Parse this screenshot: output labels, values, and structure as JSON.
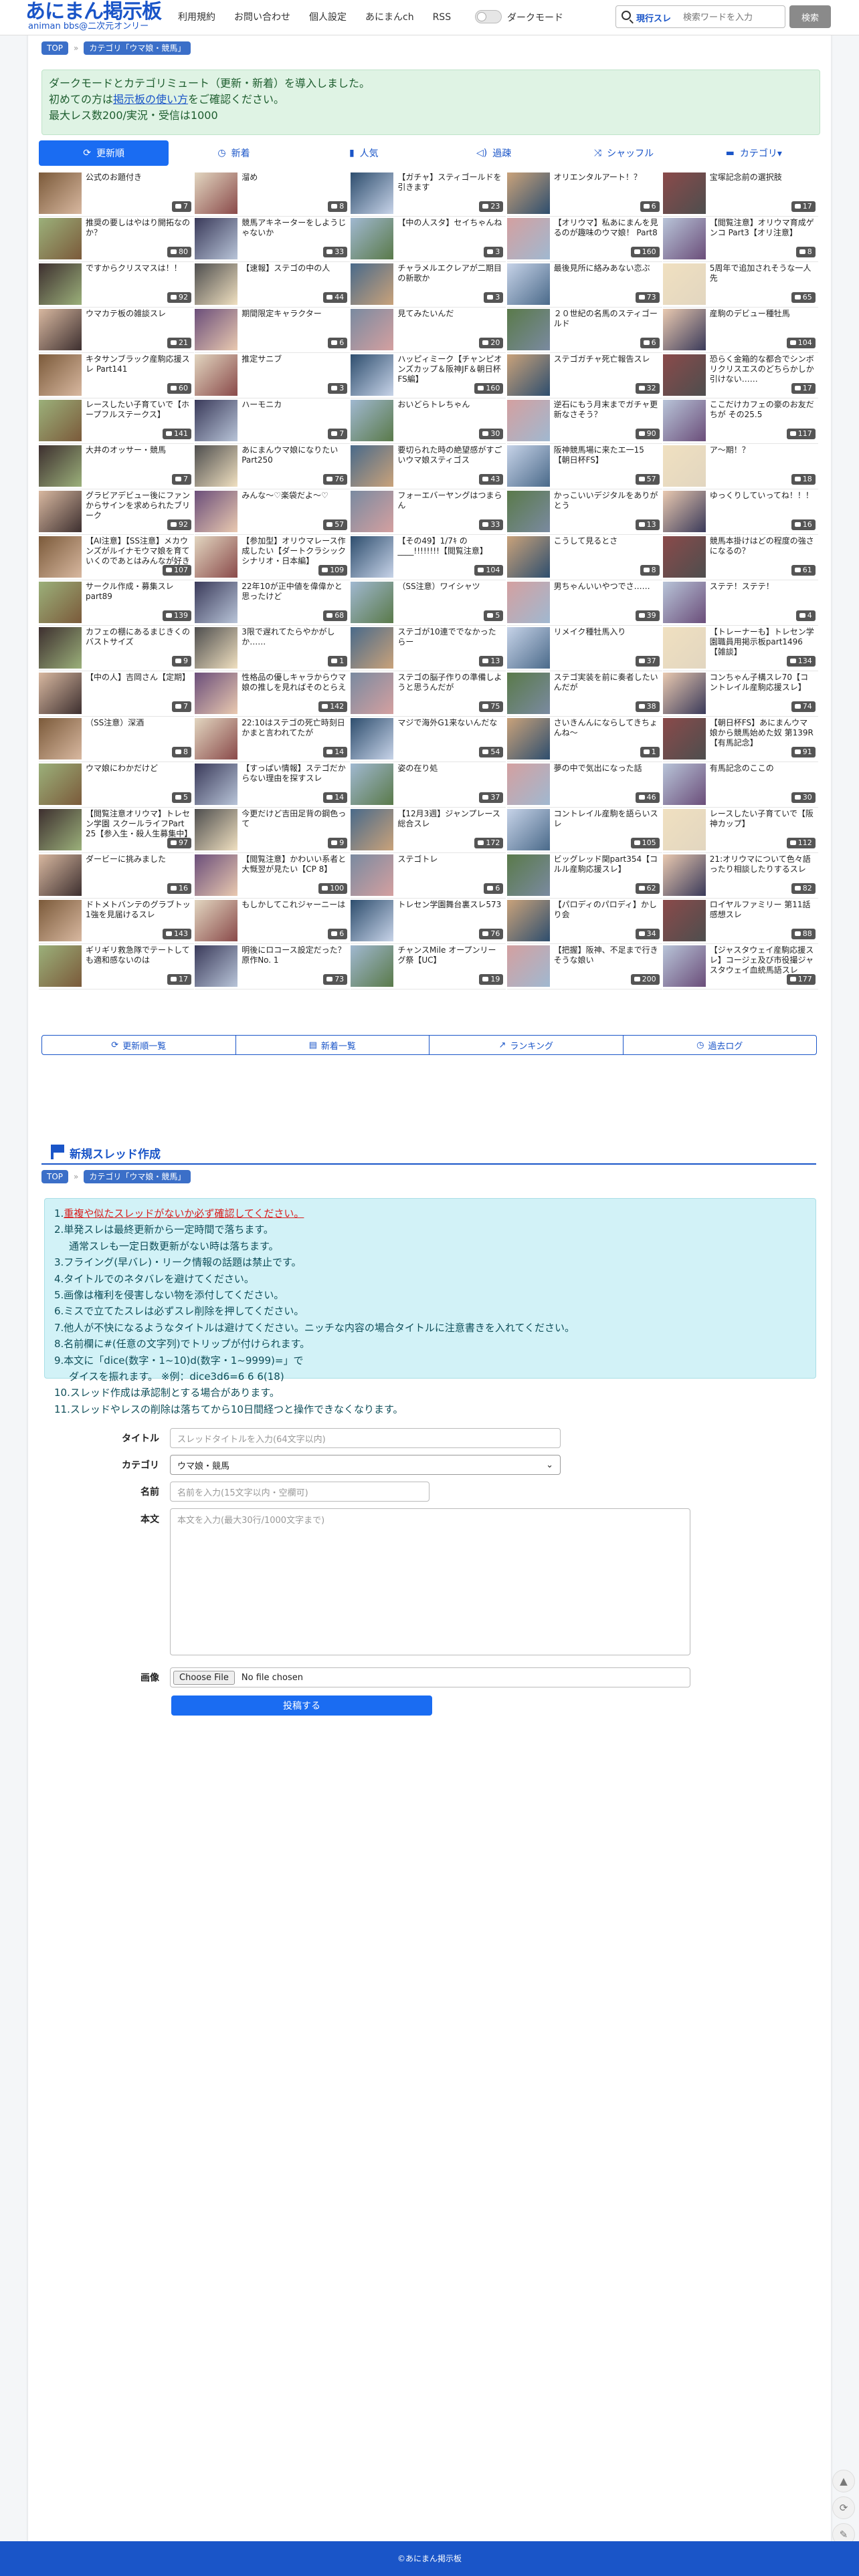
{
  "header": {
    "logo_main": "あにまん掲示板",
    "logo_sub": "animan bbs@二次元オンリー",
    "nav": [
      "利用規約",
      "お問い合わせ",
      "個人設定",
      "あにまんch",
      "RSS"
    ],
    "dark_mode_label": "ダークモード",
    "search_scope": "現行スレ",
    "search_placeholder": "検索ワードを入力",
    "search_button": "検索"
  },
  "breadcrumb": {
    "top": "TOP",
    "category": "カテゴリ「ウマ娘・競馬」"
  },
  "info": {
    "line1": "ダークモードとカテゴリミュート（更新・新着）を導入しました。",
    "line2_pre": "初めての方は",
    "line2_link": "掲示板の使い方",
    "line2_post": "をご確認ください。",
    "line3": "最大レス数200/実況・受信は1000"
  },
  "tabs": [
    {
      "label": "更新順",
      "icon": "⟳"
    },
    {
      "label": "新着",
      "icon": "◷"
    },
    {
      "label": "人気",
      "icon": "▮"
    },
    {
      "label": "過疎",
      "icon": "◁)"
    },
    {
      "label": "シャッフル",
      "icon": "⤨"
    },
    {
      "label": "カテゴリ▾",
      "icon": "▬"
    }
  ],
  "colors": {
    "accent": "#1a55c8",
    "tab_active": "#1a6cf2",
    "info_bg": "#dff3e4",
    "rules_bg": "#d2f2f7"
  },
  "threads": [
    {
      "title": "公式のお題付き",
      "count": "7"
    },
    {
      "title": "溜め",
      "count": "8"
    },
    {
      "title": "【ガチャ】スティゴールドを引きます",
      "count": "23"
    },
    {
      "title": "オリエンタルアート！？",
      "count": "6"
    },
    {
      "title": "宝塚記念前の選択肢",
      "count": "17"
    },
    {
      "title": "推奨の要しはやはり開拓なのか？",
      "count": "80"
    },
    {
      "title": "競馬アキネーターをしようじゃないか",
      "count": "33"
    },
    {
      "title": "【中の人スタ】セイちゃんね",
      "count": "3"
    },
    {
      "title": "【オリウマ】私あにまんを見るのが趣味のウマ娘！ Part8",
      "count": "160"
    },
    {
      "title": "【閲覧注意】オリウマ育成ゲンコ Part3【オリ注意】",
      "count": "8"
    },
    {
      "title": "ですからクリスマスは！！",
      "count": "92"
    },
    {
      "title": "【速報】ステゴの中の人",
      "count": "44"
    },
    {
      "title": "チャラメルエクレアが二期目の新歌か",
      "count": "3"
    },
    {
      "title": "最後見所に絡みあない恋ぶ",
      "count": "73"
    },
    {
      "title": "5周年で追加されそうな一人 先",
      "count": "65"
    },
    {
      "title": "ウマカテ板の雑談スレ",
      "count": "21"
    },
    {
      "title": "期間限定キャラクター",
      "count": "6"
    },
    {
      "title": "見てみたいんだ",
      "count": "20"
    },
    {
      "title": "２０世紀の名馬のスティゴールド",
      "count": "6"
    },
    {
      "title": "産駒のデビュー種牡馬",
      "count": "104"
    },
    {
      "title": "キタサンブラック産駒応援スレ Part141",
      "count": "60"
    },
    {
      "title": "推定サニブ",
      "count": "3"
    },
    {
      "title": "ハッピィミーク【チャンピオンズカップ＆阪神JF＆朝日杯FS編】",
      "count": "160"
    },
    {
      "title": "ステゴガチャ死亡報告スレ",
      "count": "32"
    },
    {
      "title": "恐らく金箱的な都合でシンボリクリスエスのどちらかしか引けない……",
      "count": "17"
    },
    {
      "title": "レースしたい子育ていで【ホープフルステークス】",
      "count": "141"
    },
    {
      "title": "ハーモニカ",
      "count": "7"
    },
    {
      "title": "おいどらトレちゃん",
      "count": "30"
    },
    {
      "title": "逆石にもう月末までガチャ更新なさそう？",
      "count": "90"
    },
    {
      "title": "ここだけカフェの豪のお友だちが その25.5",
      "count": "117"
    },
    {
      "title": "大井のオッサー・競馬",
      "count": "7"
    },
    {
      "title": "あにまんウマ娘になりたいPart250",
      "count": "76"
    },
    {
      "title": "要切られた時の絶望感がすごいウマ娘スティゴス",
      "count": "43"
    },
    {
      "title": "阪神競馬場に来たエ一15【朝日杯FS】",
      "count": "57"
    },
    {
      "title": "ア〜期！？",
      "count": "18"
    },
    {
      "title": "グラビアデビュー後にファンからサインを求められたブリーク",
      "count": "92"
    },
    {
      "title": "みんな〜♡楽袋だよ〜♡",
      "count": "57"
    },
    {
      "title": "フォーエバーヤングはつまらん",
      "count": "33"
    },
    {
      "title": "かっこいいデジタルをありがとう",
      "count": "13"
    },
    {
      "title": "ゆっくりしていってね！！！",
      "count": "16"
    },
    {
      "title": "【AI注意】【SS注意】メカウンズがルイナモウマ娘を育ていくのであとはみんなが好きにしてくれ12",
      "count": "107"
    },
    {
      "title": "【参加型】オリウマレース作成したい【ダートクラシックシナリオ・日本編】",
      "count": "109"
    },
    {
      "title": "【その49】1/7ｷ の____!!!!!!!!【閲覧注意】",
      "count": "104"
    },
    {
      "title": "こうして見るとさ",
      "count": "8"
    },
    {
      "title": "競馬本掛けはどの程度の強さになるの？",
      "count": "61"
    },
    {
      "title": "サークル作成・募集スレ part89",
      "count": "139"
    },
    {
      "title": "22年10が正中値を偉偉かと思ったけど",
      "count": "68"
    },
    {
      "title": "（SS注意）ワイシャツ",
      "count": "5"
    },
    {
      "title": "男ちゃんいいやつでさ……",
      "count": "39"
    },
    {
      "title": "ステテ！ステテ！",
      "count": "4"
    },
    {
      "title": "カフェの棚にあるまじきくのバストサイズ",
      "count": "9"
    },
    {
      "title": "3限で遅れてたらやかがしか……",
      "count": "1"
    },
    {
      "title": "ステゴが10連ででなかったらー",
      "count": "13"
    },
    {
      "title": "リメイク種牡馬入り",
      "count": "37"
    },
    {
      "title": "【トレーナーも】トレセン学園職員用掲示板part1496【雑談】",
      "count": "134"
    },
    {
      "title": "【中の人】吉岡さん【定期】",
      "count": "7"
    },
    {
      "title": "性格品の優しキャラからウマ娘の推しを見ればそのとらえ",
      "count": "142"
    },
    {
      "title": "ステゴの脳子作りの準備しようと思うんだが",
      "count": "75"
    },
    {
      "title": "ステゴ実装を前に奏者したいんだが",
      "count": "38"
    },
    {
      "title": "コンちゃん子構スレ70【コントレイル産駒応援スレ】",
      "count": "74"
    },
    {
      "title": "（SS注意）深酒",
      "count": "8"
    },
    {
      "title": "22:10はステゴの死亡時刻日かまと言われてたが",
      "count": "14"
    },
    {
      "title": "マジで海外G1来ないんだな",
      "count": "54"
    },
    {
      "title": "さいきんんにならしてきちょんね〜",
      "count": "1"
    },
    {
      "title": "【朝日杯FS】あにまんウマ娘から競馬始めた奴 第139R【有馬記念】",
      "count": "91"
    },
    {
      "title": "ウマ娘にわかだけど",
      "count": "5"
    },
    {
      "title": "【すっぱい情報】ステゴだからない理由を探すスレ",
      "count": "14"
    },
    {
      "title": "姿の在り処",
      "count": "37"
    },
    {
      "title": "夢の中で気出になった話",
      "count": "46"
    },
    {
      "title": "有馬記念のここの",
      "count": "30"
    },
    {
      "title": "【閲覧注意オリウマ】トレセン学園 スクールライフPart 25【参入生・殺人生募集中】",
      "count": "97"
    },
    {
      "title": "今更だけど吉田足背の鋼色って",
      "count": "9"
    },
    {
      "title": "【12月3週】ジャンプレース総合スレ",
      "count": "172"
    },
    {
      "title": "コントレイル産駒を語らいスレ",
      "count": "105"
    },
    {
      "title": "レースしたい子育ていで【阪神カップ】",
      "count": "112"
    },
    {
      "title": "ダービーに挑みました",
      "count": "16"
    },
    {
      "title": "【閲覧注意】かわいい系者と大慨翌が見たい【CP 8】",
      "count": "100"
    },
    {
      "title": "ステゴトレ",
      "count": "6"
    },
    {
      "title": "ビッグレッド関part354【コルル産駒応援スレ】",
      "count": "62"
    },
    {
      "title": "21:オリウマについて色々語ったり相談したりするスレ",
      "count": "82"
    },
    {
      "title": "ドトメトバンテのグラブトッ1強を見届けるスレ",
      "count": "143"
    },
    {
      "title": "もしかしてこれジャーニーは",
      "count": "6"
    },
    {
      "title": "トレセン学園舞台裏スレ573",
      "count": "76"
    },
    {
      "title": "【パロディのパロディ】かしり会",
      "count": "34"
    },
    {
      "title": "ロイヤルファミリー 第11話感想スレ",
      "count": "88"
    },
    {
      "title": "ギリギリ救急隊でテートして も適和感ないのは",
      "count": "17"
    },
    {
      "title": "明後にロコース設定だった？原作No. 1",
      "count": "73"
    },
    {
      "title": "チャンスMile オープンリーグ祭【UC】",
      "count": "19"
    },
    {
      "title": "【把握】阪神、不足まで行きそうな娘い",
      "count": "200"
    },
    {
      "title": "【ジャスタウェイ産駒応援スレ】コージェ及び市役撮ジャスタウェイ血統馬語スレ",
      "count": "177"
    }
  ],
  "thumb_palette": [
    "#7b5a3a",
    "#c9a27a",
    "#3a3a5a",
    "#b8c4d8",
    "#4a6a8a",
    "#d8b8a0",
    "#5a7a4a",
    "#e2d6c0",
    "#8a4a4a",
    "#a0b8d0",
    "#3d2f2f",
    "#c7d3e8",
    "#6b4e7a",
    "#e9c9b0",
    "#2e4e6e",
    "#9bb07a",
    "#d4a0a0",
    "#4e4e4e",
    "#f0e0c0",
    "#7a8aa0"
  ],
  "links": [
    {
      "label": "更新順一覧",
      "icon": "⟳"
    },
    {
      "label": "新着一覧",
      "icon": "▤"
    },
    {
      "label": "ランキング",
      "icon": "↗"
    },
    {
      "label": "過去ログ",
      "icon": "◷"
    }
  ],
  "new_thread": {
    "heading": "新規スレッド作成",
    "rules": {
      "r1_pre": "1.",
      "r1_warn": "重複や似たスレッドがないか必ず確認してください。",
      "r2": "2.単発スレは最終更新から一定時間で落ちます。",
      "r2b": "通常スレも一定日数更新がない時は落ちます。",
      "r3": "3.フライング(早バレ)・リーク情報の話題は禁止です。",
      "r4": "4.タイトルでのネタバレを避けてください。",
      "r5": "5.画像は権利を侵害しない物を添付してください。",
      "r6": "6.ミスで立てたスレは必ずスレ削除を押してください。",
      "r7": "7.他人が不快になるようなタイトルは避けてください。ニッチな内容の場合タイトルに注意書きを入れてください。",
      "r8": "8.名前欄に#(任意の文字列)でトリップが付けられます。",
      "r9": "9.本文に「dice(数字・1~10)d(数字・1~9999)=」で",
      "r9b": "ダイスを振れます。 ※例：dice3d6=6 6 6(18)",
      "r10": "10.スレッド作成は承認制とする場合があります。",
      "r11": "11.スレッドやレスの削除は落ちてから10日間経つと操作できなくなります。"
    },
    "title_label": "タイトル",
    "title_placeholder": "スレッドタイトルを入力(64文字以内)",
    "category_label": "カテゴリ",
    "category_value": "ウマ娘・競馬",
    "name_label": "名前",
    "name_placeholder": "名前を入力(15文字以内・空欄可)",
    "body_label": "本文",
    "body_placeholder": "本文を入力(最大30行/1000文字まで)",
    "image_label": "画像",
    "file_button": "Choose File",
    "file_status": "No file chosen",
    "submit": "投稿する"
  },
  "footer": "©あにまん掲示板"
}
